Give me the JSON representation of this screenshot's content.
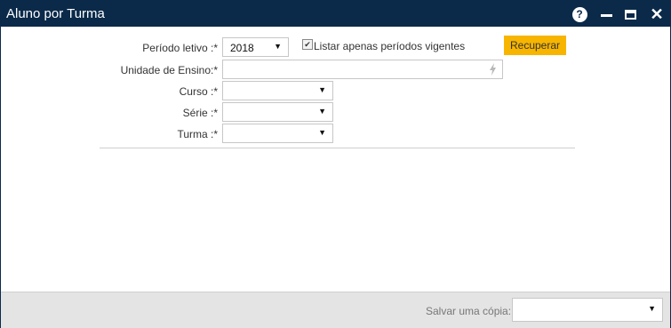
{
  "window": {
    "title": "Aluno por Turma"
  },
  "titlebar": {
    "help": "?",
    "close": "✕"
  },
  "form": {
    "periodo": {
      "label": "Período letivo :*",
      "value": "2018"
    },
    "listar": {
      "label": "Listar apenas períodos vigentes",
      "checked": true
    },
    "recuperar_label": "Recuperar",
    "unidade": {
      "label": "Unidade de Ensino:*",
      "value": ""
    },
    "curso": {
      "label": "Curso :*",
      "value": ""
    },
    "serie": {
      "label": "Série :*",
      "value": ""
    },
    "turma": {
      "label": "Turma :*",
      "value": ""
    }
  },
  "footer": {
    "save_label": "Salvar uma cópia:",
    "save_value": ""
  },
  "colors": {
    "titlebar": "#0b2a4a",
    "accent_button": "#f7b500"
  }
}
